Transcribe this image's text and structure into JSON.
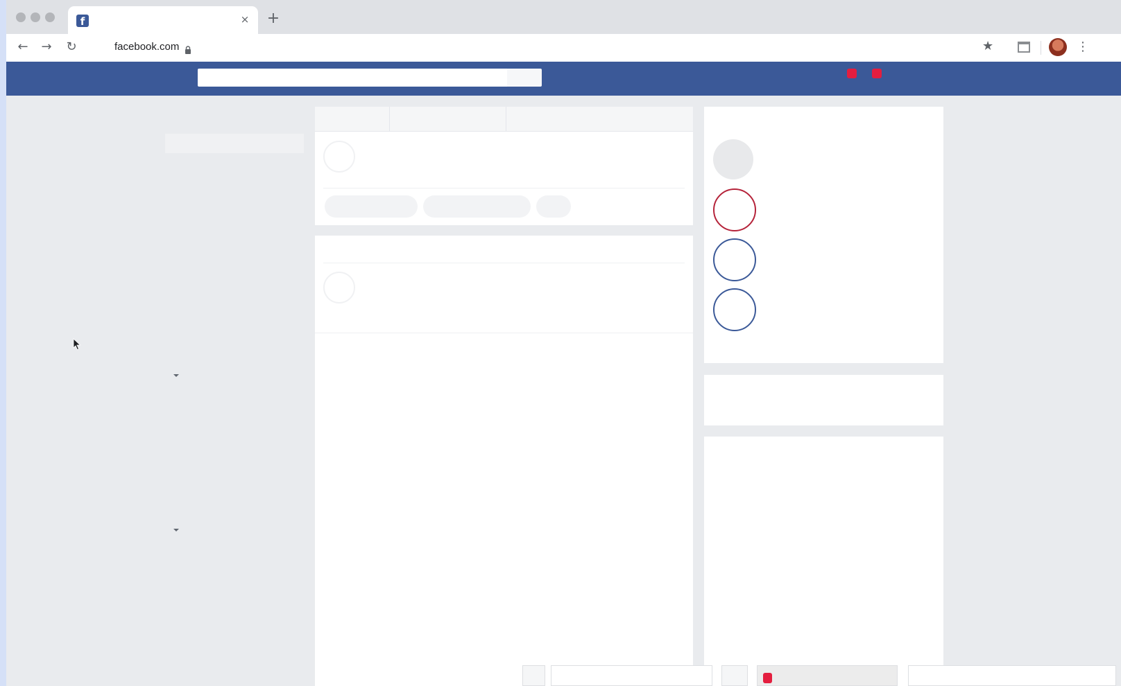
{
  "browser": {
    "tab": {
      "title": "",
      "close_glyph": "×",
      "favicon_letter": "f",
      "favicon_icon": "facebook-logo-icon"
    },
    "new_tab_glyph": "+",
    "nav": {
      "back_glyph": "←",
      "forward_glyph": "→",
      "reload_glyph": "↻"
    },
    "address_bar": {
      "url": "facebook.com",
      "secure_icon": "lock-icon"
    },
    "bookmark_glyph": "★",
    "menu_glyph": "⋮",
    "extension_icon": "cast-icon",
    "profile_icon": "avatar"
  },
  "facebook": {
    "header_color": "#3b5998",
    "search": {
      "placeholder": ""
    },
    "notification_color": "#e41e3f"
  },
  "right_column": {
    "story_rings": [
      {
        "state": "loading",
        "color": "#e8e9eb"
      },
      {
        "state": "unseen",
        "color": "#b5233a"
      },
      {
        "state": "seen",
        "color": "#3b5998"
      },
      {
        "state": "seen",
        "color": "#3b5998"
      }
    ]
  }
}
